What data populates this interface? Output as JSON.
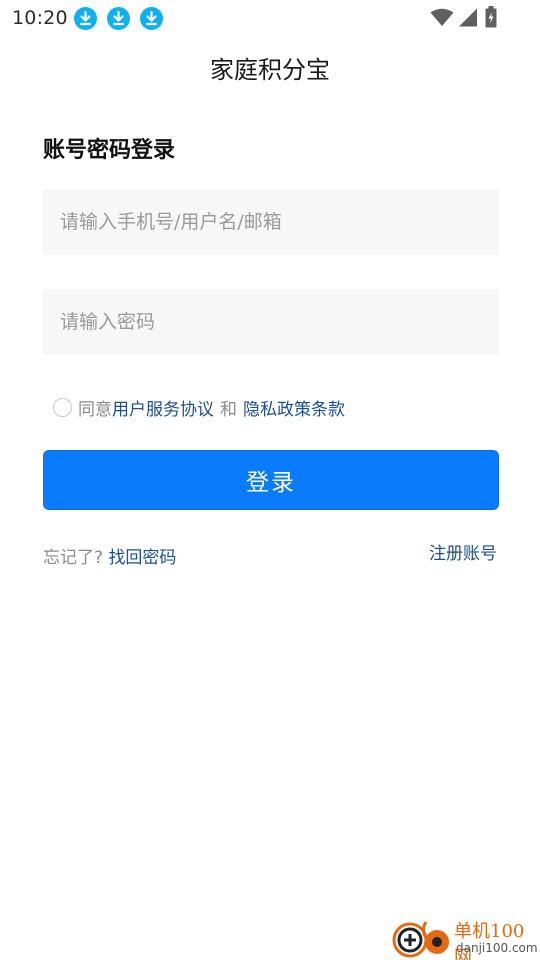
{
  "status_bar": {
    "time": "10:20",
    "icons": [
      "download-icon",
      "download-icon",
      "download-icon",
      "wifi-icon",
      "signal-icon",
      "battery-charging-icon"
    ],
    "download_color": "#0fb0f0"
  },
  "app": {
    "title": "家庭积分宝"
  },
  "login": {
    "heading": "账号密码登录",
    "phone_placeholder": "请输入手机号/用户名/邮箱",
    "phone_value": "",
    "password_placeholder": "请输入密码",
    "password_value": "",
    "agree_prefix": "同意",
    "agree_terms": "用户服务协议",
    "agree_and": "和",
    "agree_privacy": "隐私政策条款",
    "agree_checked": false,
    "button_label": "登录",
    "forgot_text": "忘记了?",
    "forgot_link": "找回密码",
    "register_link": "注册账号"
  },
  "colors": {
    "primary_button": "#0a7bfb",
    "link": "#1d4f8c",
    "input_bg": "#f7f7f7"
  },
  "watermark": {
    "name": "单机100网",
    "url": "danji100.com"
  }
}
